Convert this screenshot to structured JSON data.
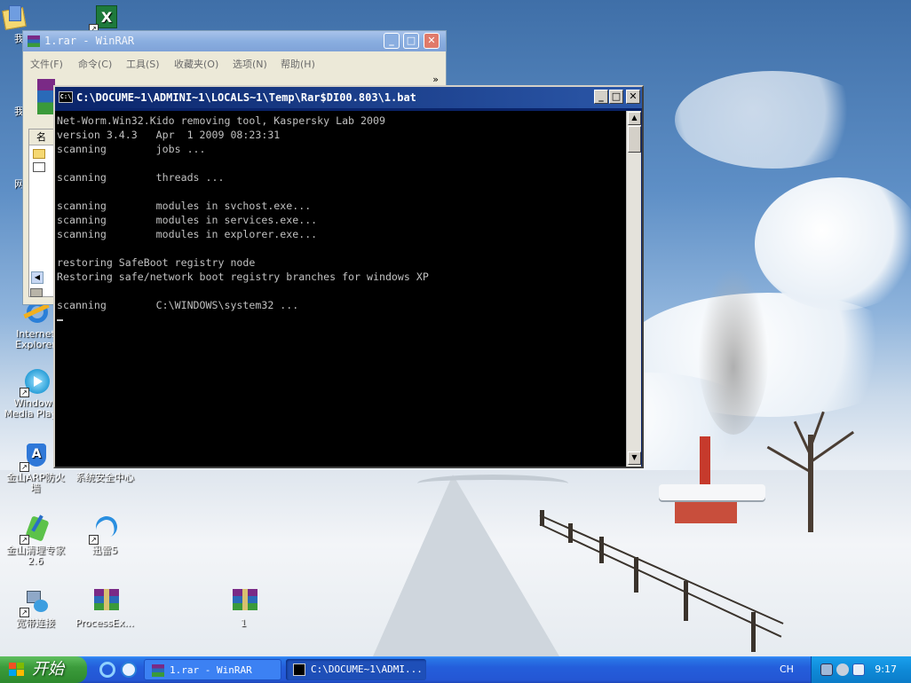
{
  "desktop": {
    "icons": [
      {
        "label": "我",
        "icon": "folder-documents-icon"
      },
      {
        "label": "我",
        "icon": "computer-icon"
      },
      {
        "label": "网",
        "icon": "network-icon"
      },
      {
        "label": "Internet Explorer",
        "icon": "ie-icon"
      },
      {
        "label": "Windows Media Player",
        "icon": "media-player-icon"
      },
      {
        "label": "金山ARP防火墙",
        "icon": "arp-firewall-icon"
      },
      {
        "label": "系统安全中心",
        "icon": "security-center-icon"
      },
      {
        "label": "金山清理专家 2.6",
        "icon": "cleaner-icon"
      },
      {
        "label": "迅雷5",
        "icon": "thunder-icon"
      },
      {
        "label": "宽带连接",
        "icon": "broadband-icon"
      },
      {
        "label": "ProcessEx...",
        "icon": "rar-archive-icon"
      },
      {
        "label": "1",
        "icon": "rar-archive-icon"
      }
    ]
  },
  "winrar": {
    "title": "1.rar - WinRAR",
    "menu": [
      "文件(F)",
      "命令(C)",
      "工具(S)",
      "收藏夹(O)",
      "选项(N)",
      "帮助(H)"
    ],
    "column_header": "名"
  },
  "console": {
    "title": "C:\\DOCUME~1\\ADMINI~1\\LOCALS~1\\Temp\\Rar$DI00.803\\1.bat",
    "lines": [
      "Net-Worm.Win32.Kido removing tool, Kaspersky Lab 2009",
      "version 3.4.3   Apr  1 2009 08:23:31",
      "scanning        jobs ...",
      "",
      "scanning        threads ...",
      "",
      "scanning        modules in svchost.exe...",
      "scanning        modules in services.exe...",
      "scanning        modules in explorer.exe...",
      "",
      "restoring SafeBoot registry node",
      "Restoring safe/network boot registry branches for windows XP",
      "",
      "scanning        C:\\WINDOWS\\system32 ..."
    ]
  },
  "taskbar": {
    "start_label": "开始",
    "tasks": [
      {
        "label": "1.rar - WinRAR",
        "icon": "winrar-icon",
        "active": false
      },
      {
        "label": "C:\\DOCUME~1\\ADMI...",
        "icon": "console-icon",
        "active": true
      }
    ],
    "language": "CH",
    "clock": "9:17"
  },
  "colors": {
    "taskbar_blue": "#245edb",
    "start_green": "#3c9c3c",
    "console_bg": "#000000",
    "console_text": "#c0c0c0"
  }
}
